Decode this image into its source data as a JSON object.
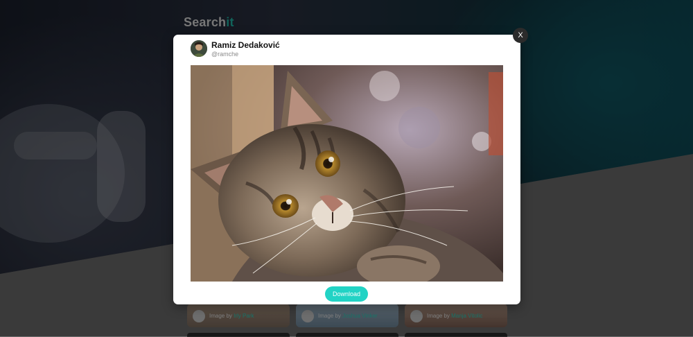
{
  "brand": {
    "prefix": "Search",
    "accent": "it",
    "accent_color": "#1fb5a5"
  },
  "gallery": {
    "cards": [
      {
        "credit_prefix": "Image by",
        "author": "Irly Park"
      },
      {
        "credit_prefix": "Image by",
        "author": "Joshua Vinker"
      },
      {
        "credit_prefix": "Image by",
        "author": "Manja Vitolic"
      }
    ]
  },
  "modal": {
    "close_label": "X",
    "author": {
      "name": "Ramiz Dedaković",
      "handle": "@ramche"
    },
    "image_subject": "tabby cat photo",
    "download_label": "Download",
    "download_color": "#22d3c5"
  }
}
